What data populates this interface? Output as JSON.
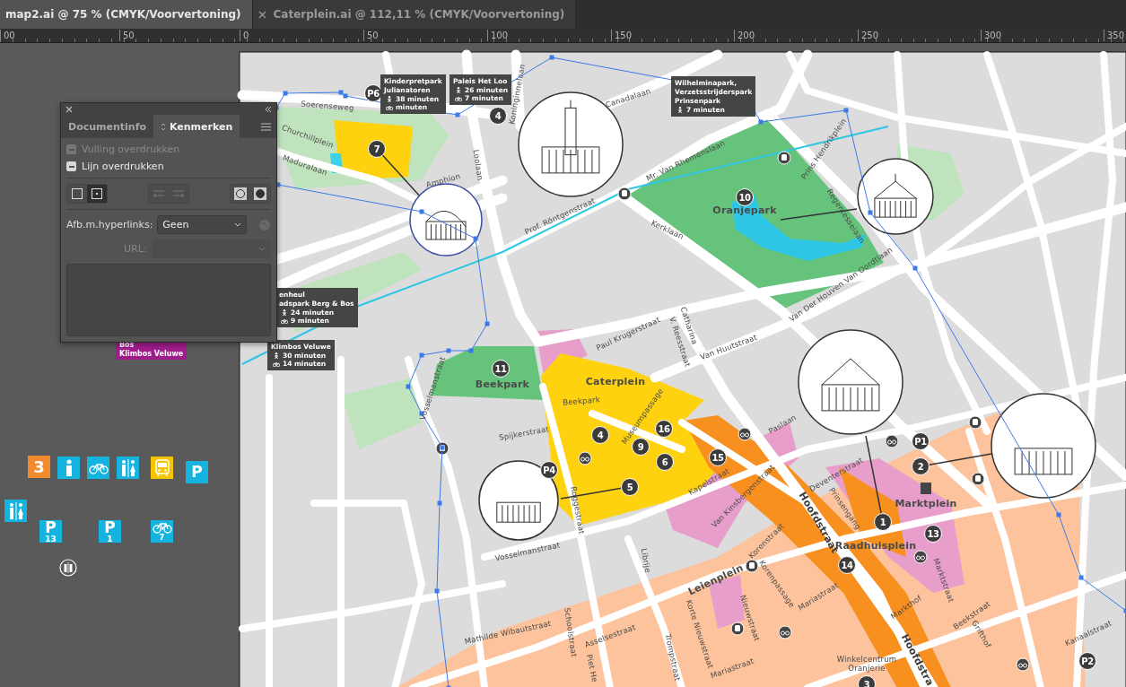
{
  "tabs": [
    {
      "label": "map2.ai @ 75 % (CMYK/Voorvertoning)",
      "selected": true
    },
    {
      "label": "Caterplein.ai @ 112,11 % (CMYK/Voorvertoning)",
      "selected": false
    }
  ],
  "ruler": {
    "ticks": [
      "00",
      "50",
      "0",
      "50",
      "100",
      "150",
      "200",
      "250",
      "300",
      "350"
    ]
  },
  "panel": {
    "tabs": [
      {
        "label": "Documentinfo",
        "selected": false
      },
      {
        "label": "Kenmerken",
        "selected": true
      }
    ],
    "options": [
      {
        "label": "Vulling overdrukken",
        "disabled": true
      },
      {
        "label": "Lijn overdrukken",
        "disabled": false
      }
    ],
    "shape_buttons": [
      {
        "selected": false
      },
      {
        "selected": true
      }
    ],
    "hyperlinks": {
      "label": "Afb.m.hyperlinks:",
      "value": "Geen"
    },
    "url": {
      "label": "URL:",
      "disabled": true
    }
  },
  "pasteboard": {
    "tag": {
      "lines": [
        "Bos",
        "Klimbos Veluwe"
      ]
    },
    "signs": [
      {
        "kind": "number",
        "text": "3"
      },
      {
        "kind": "info"
      },
      {
        "kind": "bicycle"
      },
      {
        "kind": "toilets"
      },
      {
        "kind": "bus"
      },
      {
        "kind": "parking",
        "text": "P"
      },
      {
        "kind": "toilets"
      },
      {
        "kind": "parking",
        "text": "P",
        "sub": "13"
      },
      {
        "kind": "parking",
        "text": "P",
        "sub": "1"
      },
      {
        "kind": "bicycle",
        "sub": "7"
      },
      {
        "kind": "toilet-round"
      }
    ]
  },
  "map": {
    "labels": [
      {
        "kind": "street",
        "text": "Soerenseweg"
      },
      {
        "kind": "street",
        "text": "Churchillplein"
      },
      {
        "kind": "street",
        "text": "Maduralaan"
      },
      {
        "kind": "street",
        "text": "Amphion"
      },
      {
        "kind": "street",
        "text": "Loolaan"
      },
      {
        "kind": "street",
        "text": "Koninginnelaan"
      },
      {
        "kind": "street",
        "text": "Canadalaan"
      },
      {
        "kind": "street",
        "text": "Mr. Van Rhemenslaan"
      },
      {
        "kind": "street",
        "text": "Prof. Röntgenstraat"
      },
      {
        "kind": "street",
        "text": "Kerklaan"
      },
      {
        "kind": "street",
        "text": "Prins Hendrikplein"
      },
      {
        "kind": "street",
        "text": "Regentesselaan"
      },
      {
        "kind": "street",
        "text": "Van Der Houven Van Oordtlaan"
      },
      {
        "kind": "street",
        "text": "Paul Krugerstraat"
      },
      {
        "kind": "street",
        "text": "Catharina"
      },
      {
        "kind": "street",
        "text": "V. Reesstraat"
      },
      {
        "kind": "street",
        "text": "Van Huutstraat"
      },
      {
        "kind": "street",
        "text": "Vosselmanstraat"
      },
      {
        "kind": "street",
        "text": "Beekpark"
      },
      {
        "kind": "street",
        "text": "Spijkerstraat"
      },
      {
        "kind": "street",
        "text": "Museumpassage"
      },
      {
        "kind": "street",
        "text": "Kapelstraat"
      },
      {
        "kind": "street",
        "text": "Roggestraat"
      },
      {
        "kind": "street",
        "text": "Vosselmanstraat"
      },
      {
        "kind": "street",
        "text": "Paslaan"
      },
      {
        "kind": "street",
        "text": "Van Kinsbergenstraat"
      },
      {
        "kind": "street",
        "text": "Deventerstraat"
      },
      {
        "kind": "street",
        "text": "Prinsengang"
      },
      {
        "kind": "main",
        "text": "Hoofdstraat"
      },
      {
        "kind": "street",
        "text": "Librije"
      },
      {
        "kind": "street",
        "text": "Korenstraat"
      },
      {
        "kind": "street",
        "text": "Korenpassage"
      },
      {
        "kind": "street",
        "text": "Mariastraat"
      },
      {
        "kind": "street",
        "text": "Markthof"
      },
      {
        "kind": "street",
        "text": "Korte Nieuwstraat"
      },
      {
        "kind": "street",
        "text": "Nieuwstraat"
      },
      {
        "kind": "street",
        "text": "Mathilde Wibautstraat"
      },
      {
        "kind": "street",
        "text": "Schoolstraat"
      },
      {
        "kind": "street",
        "text": "Asselsestraat"
      },
      {
        "kind": "street",
        "text": "Piet He"
      },
      {
        "kind": "street",
        "text": "Trompstraat"
      },
      {
        "kind": "street",
        "text": "Mariastraat"
      },
      {
        "kind": "street",
        "text": "Winkelcentrum"
      },
      {
        "kind": "street",
        "text": "Oranjerie"
      },
      {
        "kind": "main",
        "text": "Hoofdstra"
      },
      {
        "kind": "street",
        "text": "Marktstraat"
      },
      {
        "kind": "street",
        "text": "Beekstraat"
      },
      {
        "kind": "street",
        "text": "Grifthof"
      },
      {
        "kind": "street",
        "text": "Kanaalstraat"
      },
      {
        "kind": "place",
        "text": "Oranjepark"
      },
      {
        "kind": "place",
        "text": "Beekpark"
      },
      {
        "kind": "place",
        "text": "Caterplein"
      },
      {
        "kind": "place",
        "text": "Leienplein"
      },
      {
        "kind": "place",
        "text": "Raadhuisplein"
      },
      {
        "kind": "place",
        "text": "Marktplein"
      }
    ],
    "markers": [
      {
        "text": "P6"
      },
      {
        "text": "4"
      },
      {
        "text": "7"
      },
      {
        "text": "10"
      },
      {
        "text": "11"
      },
      {
        "text": "4"
      },
      {
        "text": "9"
      },
      {
        "text": "6"
      },
      {
        "text": "16"
      },
      {
        "text": "15"
      },
      {
        "text": "5"
      },
      {
        "text": "P4"
      },
      {
        "text": "1"
      },
      {
        "text": "2"
      },
      {
        "text": "P1"
      },
      {
        "text": "13"
      },
      {
        "text": "14"
      },
      {
        "text": "3"
      },
      {
        "text": "P2"
      }
    ],
    "callouts": [
      {
        "lines": [
          "Kinderpretpark",
          "Julianatoren"
        ],
        "walk": "38 minuten",
        "bike": "minuten"
      },
      {
        "lines": [
          "Paleis Het Loo"
        ],
        "walk": "26 minuten",
        "bike": "7 minuten"
      },
      {
        "lines": [
          "Wilhelminapark,",
          "Verzetsstrijderspark",
          "Prinsenpark"
        ],
        "walk": "7 minuten"
      },
      {
        "lines": [
          "enheul",
          "adspark Berg & Bos"
        ],
        "walk": "24 minuten",
        "bike": "9 minuten"
      },
      {
        "lines": [
          "Klimbos Veluwe"
        ],
        "walk": "30 minuten",
        "bike": "14 minuten"
      }
    ]
  }
}
